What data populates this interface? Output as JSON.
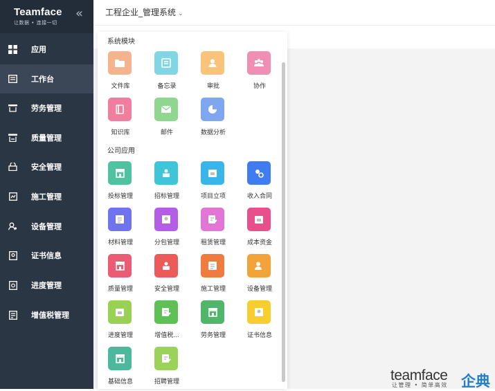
{
  "brand": {
    "name": "Teamface",
    "tagline": "让数据 • 连接一切"
  },
  "sidebar": {
    "items": [
      {
        "label": "应用",
        "icon": "grid-icon",
        "active": false
      },
      {
        "label": "工作台",
        "icon": "workbench-icon",
        "active": true
      },
      {
        "label": "劳务管理",
        "icon": "labor-icon",
        "active": false
      },
      {
        "label": "质量管理",
        "icon": "quality-icon",
        "active": false
      },
      {
        "label": "安全管理",
        "icon": "safety-icon",
        "active": false
      },
      {
        "label": "施工管理",
        "icon": "construction-icon",
        "active": false
      },
      {
        "label": "设备管理",
        "icon": "equipment-icon",
        "active": false
      },
      {
        "label": "证书信息",
        "icon": "certificate-icon",
        "active": false
      },
      {
        "label": "进度管理",
        "icon": "progress-icon",
        "active": false
      },
      {
        "label": "增值税管理",
        "icon": "tax-icon",
        "active": false
      }
    ]
  },
  "header": {
    "title": "工程企业_管理系统"
  },
  "panel": {
    "system_section": "系统模块",
    "company_section": "公司应用",
    "system_apps": [
      {
        "label": "文件库",
        "color": "#f6b48e",
        "icon": "folder-icon"
      },
      {
        "label": "备忘录",
        "color": "#7fd7e6",
        "icon": "memo-icon"
      },
      {
        "label": "审批",
        "color": "#f9c47a",
        "icon": "approval-icon"
      },
      {
        "label": "协作",
        "color": "#f08fb3",
        "icon": "collaboration-icon"
      },
      {
        "label": "知识库",
        "color": "#f07e9c",
        "icon": "knowledge-icon"
      },
      {
        "label": "邮件",
        "color": "#8fd68f",
        "icon": "mail-icon"
      },
      {
        "label": "数据分析",
        "color": "#7fa7ef",
        "icon": "pie-chart-icon"
      }
    ],
    "company_apps": [
      {
        "label": "投标管理",
        "color": "#4fc2a2",
        "icon": "store-icon"
      },
      {
        "label": "招标管理",
        "color": "#3fc4d8",
        "icon": "person-doc-icon"
      },
      {
        "label": "项目立项",
        "color": "#3ab5e9",
        "icon": "calendar-icon"
      },
      {
        "label": "收入合同",
        "color": "#3f7cf0",
        "icon": "contract-icon"
      },
      {
        "label": "材料管理",
        "color": "#6f74ee",
        "icon": "list-icon"
      },
      {
        "label": "分包管理",
        "color": "#b45ee6",
        "icon": "badge-icon"
      },
      {
        "label": "租赁管理",
        "color": "#e276d6",
        "icon": "edit-doc-icon"
      },
      {
        "label": "成本资金",
        "color": "#ea4f8d",
        "icon": "calendar-icon"
      },
      {
        "label": "质量管理",
        "color": "#ec5b74",
        "icon": "store-icon"
      },
      {
        "label": "安全管理",
        "color": "#ec5a5a",
        "icon": "person-doc-icon"
      },
      {
        "label": "施工管理",
        "color": "#f07b3f",
        "icon": "list-icon"
      },
      {
        "label": "设备管理",
        "color": "#f2a33a",
        "icon": "person-icon"
      },
      {
        "label": "进度管理",
        "color": "#9ad054",
        "icon": "calendar-icon"
      },
      {
        "label": "增值税...",
        "color": "#5ec156",
        "icon": "edit-doc-icon"
      },
      {
        "label": "劳务管理",
        "color": "#4fb66a",
        "icon": "store-icon"
      },
      {
        "label": "证书信息",
        "color": "#f7cd31",
        "icon": "badge-icon"
      },
      {
        "label": "基础信息",
        "color": "#4cb99d",
        "icon": "store-icon"
      },
      {
        "label": "招聘管理",
        "color": "#9bd35a",
        "icon": "edit-doc-icon"
      }
    ]
  },
  "watermark": {
    "word": "teamface",
    "cn": "企典",
    "sub": "让管理 • 简单高效"
  }
}
